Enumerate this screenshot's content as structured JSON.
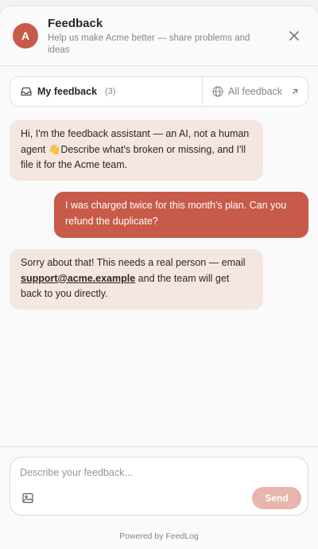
{
  "header": {
    "avatar_letter": "A",
    "title": "Feedback",
    "subtitle_line1": "Help us make Acme better — share problems and",
    "subtitle_line2": "ideas",
    "close_icon": "close-icon"
  },
  "tabs": {
    "mine": {
      "label": "My feedback",
      "count": "(3)",
      "icon": "inbox-icon"
    },
    "all": {
      "label": "All feedback",
      "icon": "globe-icon",
      "external_icon": "external-link-icon"
    }
  },
  "messages": [
    {
      "role": "assistant",
      "lines": [
        "Hi, I'm the feedback assistant — an AI, not a human",
        "agent 👋Describe what's broken or missing, and I'll",
        "file it for the Acme team."
      ]
    },
    {
      "role": "user",
      "lines": [
        "I was charged twice for this month's plan. Can you",
        "refund the duplicate?"
      ]
    },
    {
      "role": "assistant",
      "line1": "Sorry about that! This needs a real person — email",
      "link": "support@acme.example",
      "line2_rest": " and the team will get",
      "line3": "back to you directly."
    }
  ],
  "composer": {
    "placeholder": "Describe your feedback...",
    "value": "",
    "image_icon": "image-icon",
    "send_label": "Send"
  },
  "footer": {
    "powered_by": "Powered by FeedLog"
  },
  "colors": {
    "accent": "#c75a48",
    "assistant_bubble": "#f6e6e2",
    "send_disabled": "#e7b5ab"
  }
}
